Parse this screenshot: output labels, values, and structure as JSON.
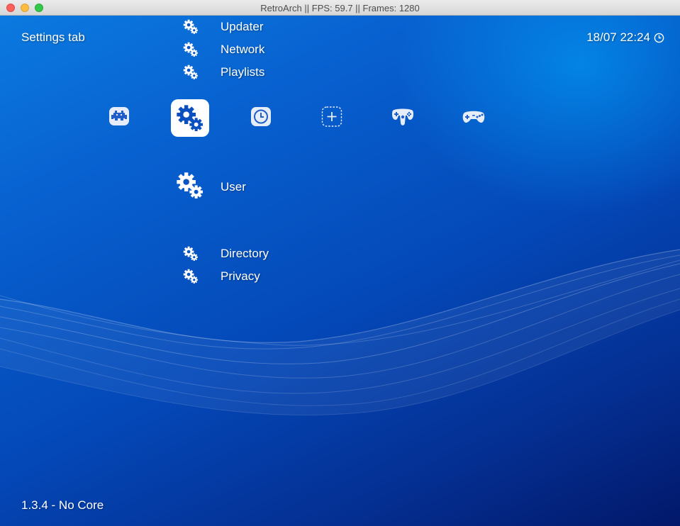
{
  "window": {
    "title": "RetroArch  || FPS:  59.7 || Frames: 1280"
  },
  "header": {
    "title": "Settings tab",
    "clock": "18/07 22:24",
    "clock_icon": "clock-icon"
  },
  "tabs": [
    {
      "name": "main-menu",
      "icon": "space-invader-icon",
      "selected": false
    },
    {
      "name": "settings",
      "icon": "gears-icon",
      "selected": true
    },
    {
      "name": "history",
      "icon": "history-clock-icon",
      "selected": false
    },
    {
      "name": "add",
      "icon": "add-plus-icon",
      "selected": false
    },
    {
      "name": "n64-controller",
      "icon": "n64-controller-icon",
      "selected": false
    },
    {
      "name": "genesis-controller",
      "icon": "genesis-controller-icon",
      "selected": false
    }
  ],
  "menu": {
    "above": [
      {
        "label": "Updater",
        "icon": "gear-icon"
      },
      {
        "label": "Network",
        "icon": "gear-icon"
      },
      {
        "label": "Playlists",
        "icon": "gear-icon"
      }
    ],
    "selected": {
      "label": "User",
      "icon": "gear-icon"
    },
    "below": [
      {
        "label": "Directory",
        "icon": "gear-icon"
      },
      {
        "label": "Privacy",
        "icon": "gear-icon"
      }
    ]
  },
  "footer": {
    "version": "1.3.4 - No Core"
  },
  "colors": {
    "background_top": "#0b7ae0",
    "background_bottom": "#02186a",
    "text": "#ffffff",
    "accent": "#0a4fc0"
  }
}
